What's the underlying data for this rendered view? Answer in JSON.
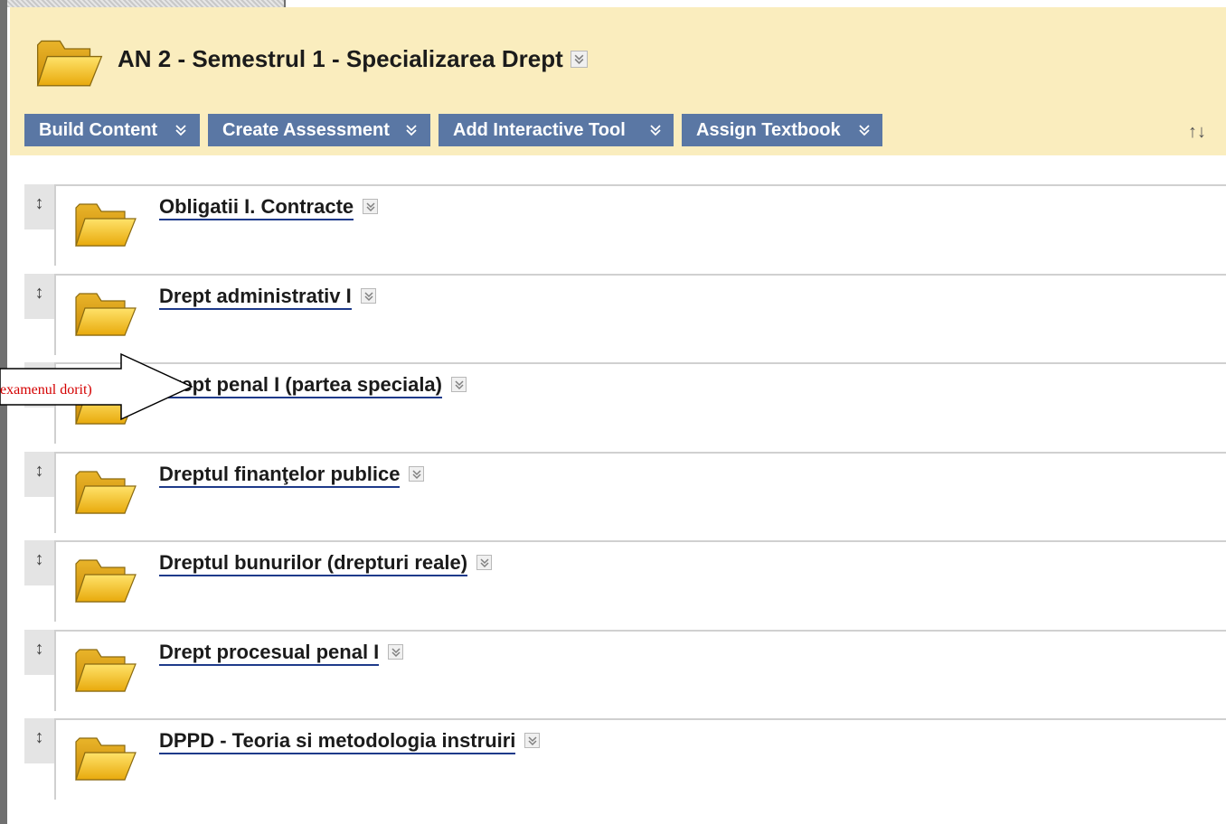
{
  "page": {
    "title": "AN 2 - Semestrul 1 - Specializarea Drept"
  },
  "action_bar": {
    "buttons": [
      {
        "label": "Build Content"
      },
      {
        "label": "Create Assessment"
      },
      {
        "label": "Add Interactive Tool"
      },
      {
        "label": "Assign Textbook"
      }
    ],
    "sort_icon": "↑↓"
  },
  "items": [
    {
      "title": "Obligatii I. Contracte"
    },
    {
      "title": "Drept administrativ I"
    },
    {
      "title": "Drept penal I (partea speciala)"
    },
    {
      "title": "Dreptul finanţelor publice"
    },
    {
      "title": "Dreptul bunurilor (drepturi reale)"
    },
    {
      "title": "Drept procesual penal I"
    },
    {
      "title": "DPPD - Teoria si metodologia instruiri"
    }
  ],
  "callout": {
    "text": "examenul dorit)"
  },
  "icons": {
    "folder": "folder-icon",
    "context_menu": "chevron-double-down-icon",
    "drag": "drag-handle-icon",
    "sort": "sort-icon"
  },
  "colors": {
    "header_bg": "#faedbe",
    "action_button_bg": "#5a77a4",
    "callout_text": "#d40000",
    "link_underline": "#1e3a8a",
    "folder_fill": "#f5c518"
  }
}
